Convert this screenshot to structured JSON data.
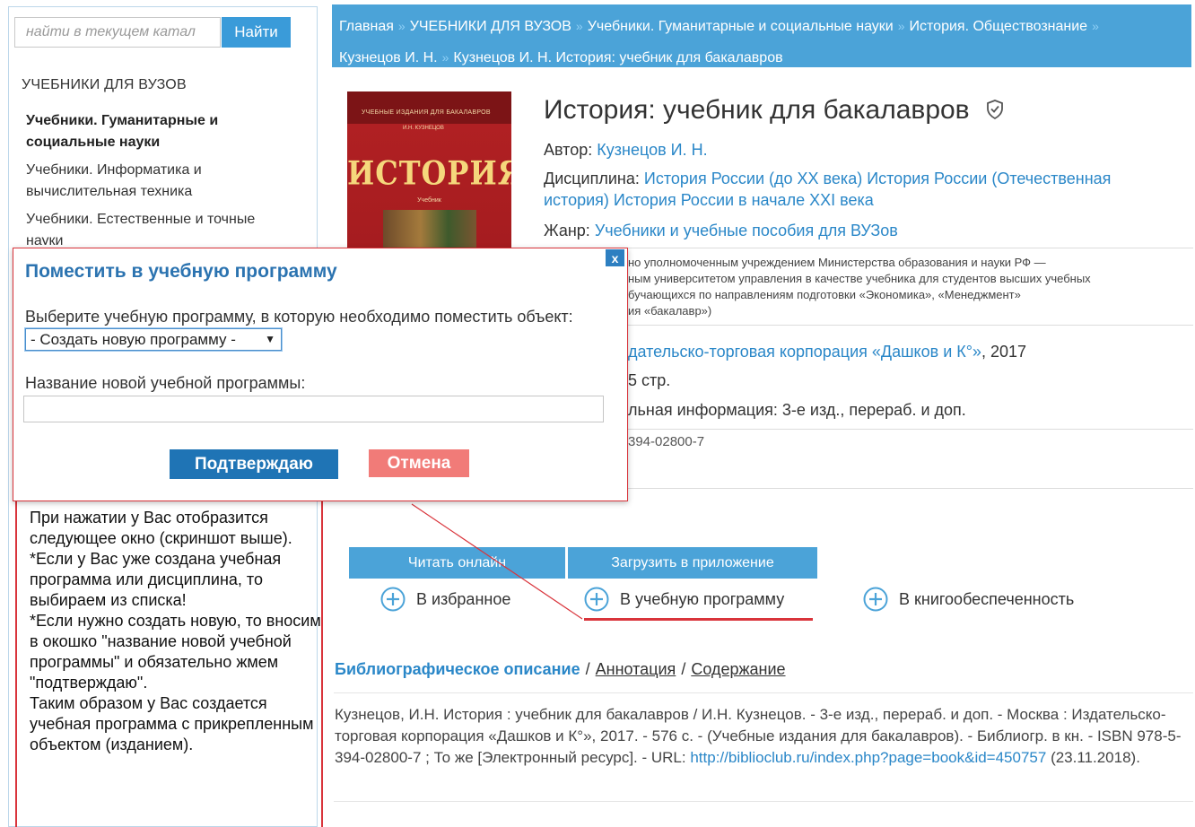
{
  "search": {
    "placeholder": "найти в текущем катал",
    "button": "Найти"
  },
  "sidebar": {
    "heading": "УЧЕБНИКИ ДЛЯ ВУЗОВ",
    "items": [
      {
        "label": "Учебники. Гуманитарные и социальные науки",
        "active": true
      },
      {
        "label": "Учебники. Информатика и вычислительная техника",
        "active": false
      },
      {
        "label": "Учебники. Естественные и точные науки",
        "active": false
      }
    ]
  },
  "annotation": {
    "lines": [
      "При нажатии у Вас отобразится следующее окно (скриншот выше).",
      "*Если у Вас уже создана учебная программа или дисциплина, то выбираем из списка!",
      "*Если нужно создать новую, то вносим в окошко \"название новой учебной программы\" и обязательно жмем \"подтверждаю\".",
      "Таким образом у Вас создается учебная программа с прикрепленным объектом (изданием)."
    ]
  },
  "breadcrumb": [
    "Главная",
    "УЧЕБНИКИ ДЛЯ ВУЗОВ",
    "Учебники. Гуманитарные и социальные науки",
    "История. Обществознание",
    "Кузнецов И. Н.",
    "Кузнецов И. Н. История: учебник для бакалавров"
  ],
  "cover": {
    "series": "УЧЕБНЫЕ ИЗДАНИЯ ДЛЯ БАКАЛАВРОВ",
    "author": "И.Н. КУЗНЕЦОВ",
    "title": "ИСТОРИЯ",
    "subtitle": "Учебник"
  },
  "book": {
    "title": "История: учебник для бакалавров",
    "author_label": "Автор:",
    "author": "Кузнецов И. Н.",
    "discipline_label": "Дисциплина:",
    "discipline": "История России (до XX века) История России (Отечественная история) История России в начале XXI века",
    "genre_label": "Жанр:",
    "genre": "Учебники и учебные пособия для ВУЗов",
    "approval_lines": [
      "но уполномоченным учреждением Министерства образования и науки РФ —",
      "ным университетом управления в качестве учебника для студентов высших учебных",
      "бучающихся по направлениям подготовки «Экономика», «Менеджмент»",
      "ия «бакалавр»)"
    ],
    "publisher": "Издательско-торговая корпорация «Дашков и К°»",
    "publisher_prefix": "дательско-торговая корпорация «Дашков и К°»",
    "year": ", 2017",
    "pages": "стр.",
    "pages_prefix": "5",
    "extra_info": "льная информация: 3-е изд., перераб. и доп.",
    "isbn": "394-02800-7"
  },
  "actions": {
    "read_online": "Читать онлайн",
    "load_app": "Загрузить в приложение",
    "favorite": "В избранное",
    "program": "В учебную программу",
    "supply": "В книгообеспеченность"
  },
  "tabs": {
    "active": "Библиографическое описание",
    "annotation": "Аннотация",
    "contents": "Содержание",
    "sep": "/"
  },
  "bibliography": {
    "text": "Кузнецов, И.Н. История : учебник для бакалавров / И.Н. Кузнецов. - 3-е изд., перераб. и доп. - Москва : Издательско-торговая корпорация «Дашков и К°», 2017. - 576 с. - (Учебные издания для бакалавров). - Библиогр. в кн. - ISBN 978-5-394-02800-7 ; То же [Электронный ресурс]. - URL: ",
    "url": "http://biblioclub.ru/index.php?page=book&id=450757",
    "date": " (23.11.2018)."
  },
  "modal": {
    "title": "Поместить в учебную программу",
    "close": "x",
    "select_label": "Выберите учебную программу, в которую необходимо поместить объект:",
    "select_value": "- Создать новую программу -",
    "name_label": "Название новой учебной программы:",
    "name_value": "",
    "confirm": "Подтверждаю",
    "cancel": "Отмена"
  },
  "colors": {
    "accent": "#4ba3d8",
    "link": "#2a87c8",
    "modal_title": "#2b73b0",
    "confirm": "#1f74b5",
    "cancel": "#f17b78",
    "annotation_red": "#d9343b"
  }
}
